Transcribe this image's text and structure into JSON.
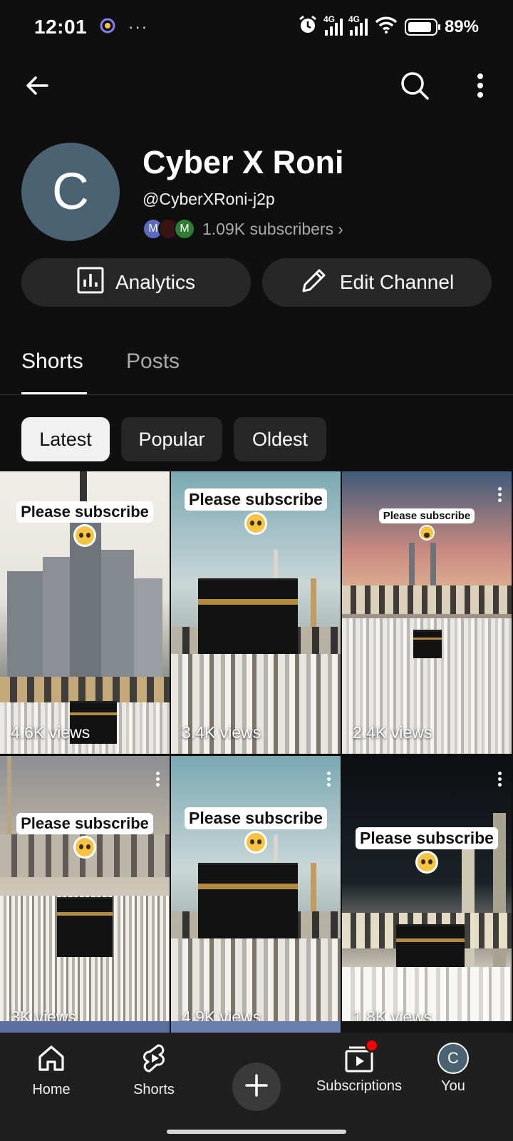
{
  "status_bar": {
    "time": "12:01",
    "overflow": "···",
    "network_1": "4G",
    "network_2": "4G",
    "battery": "89%",
    "battery_level": 0.89,
    "icons": [
      "alarm-icon",
      "signal-icon",
      "wifi-icon",
      "battery-icon"
    ]
  },
  "topbar": {
    "icons": [
      "back-arrow-icon",
      "search-icon",
      "more-vertical-icon"
    ]
  },
  "channel": {
    "avatar_letter": "C",
    "name": "Cyber X Roni",
    "handle": "@CyberXRoni-j2p",
    "subscriber_avatars": [
      {
        "letter": "M",
        "color": "#5c6bc0"
      },
      {
        "letter": "",
        "color": "#3a1414"
      },
      {
        "letter": "M",
        "color": "#2e7d32"
      }
    ],
    "subscribers": "1.09K subscribers",
    "subscribers_chevron": "›"
  },
  "actions": {
    "analytics": "Analytics",
    "edit_channel": "Edit Channel"
  },
  "tabs": [
    {
      "label": "Shorts",
      "active": true
    },
    {
      "label": "Posts",
      "active": false
    }
  ],
  "chips": [
    {
      "label": "Latest",
      "active": true
    },
    {
      "label": "Popular",
      "active": false
    },
    {
      "label": "Oldest",
      "active": false
    }
  ],
  "shorts": [
    {
      "caption": "Please subscribe",
      "views": "4.6K views"
    },
    {
      "caption": "Please subscribe",
      "views": "3.4K views"
    },
    {
      "caption": "Please subscribe",
      "views": "2.4K views"
    },
    {
      "caption": "Please subscribe",
      "views": "3K views"
    },
    {
      "caption": "Please subscribe",
      "views": "4.9K views"
    },
    {
      "caption": "Please subscribe",
      "views": "1.8K views"
    }
  ],
  "bottom_nav": {
    "items": [
      {
        "label": "Home",
        "icon": "home-icon"
      },
      {
        "label": "Shorts",
        "icon": "shorts-icon"
      },
      {
        "label": "",
        "icon": "plus-icon"
      },
      {
        "label": "Subscriptions",
        "icon": "subscriptions-icon",
        "badge": true,
        "badge_color": "#ff0000"
      },
      {
        "label": "You",
        "icon": "avatar"
      }
    ],
    "you_avatar_letter": "C"
  }
}
